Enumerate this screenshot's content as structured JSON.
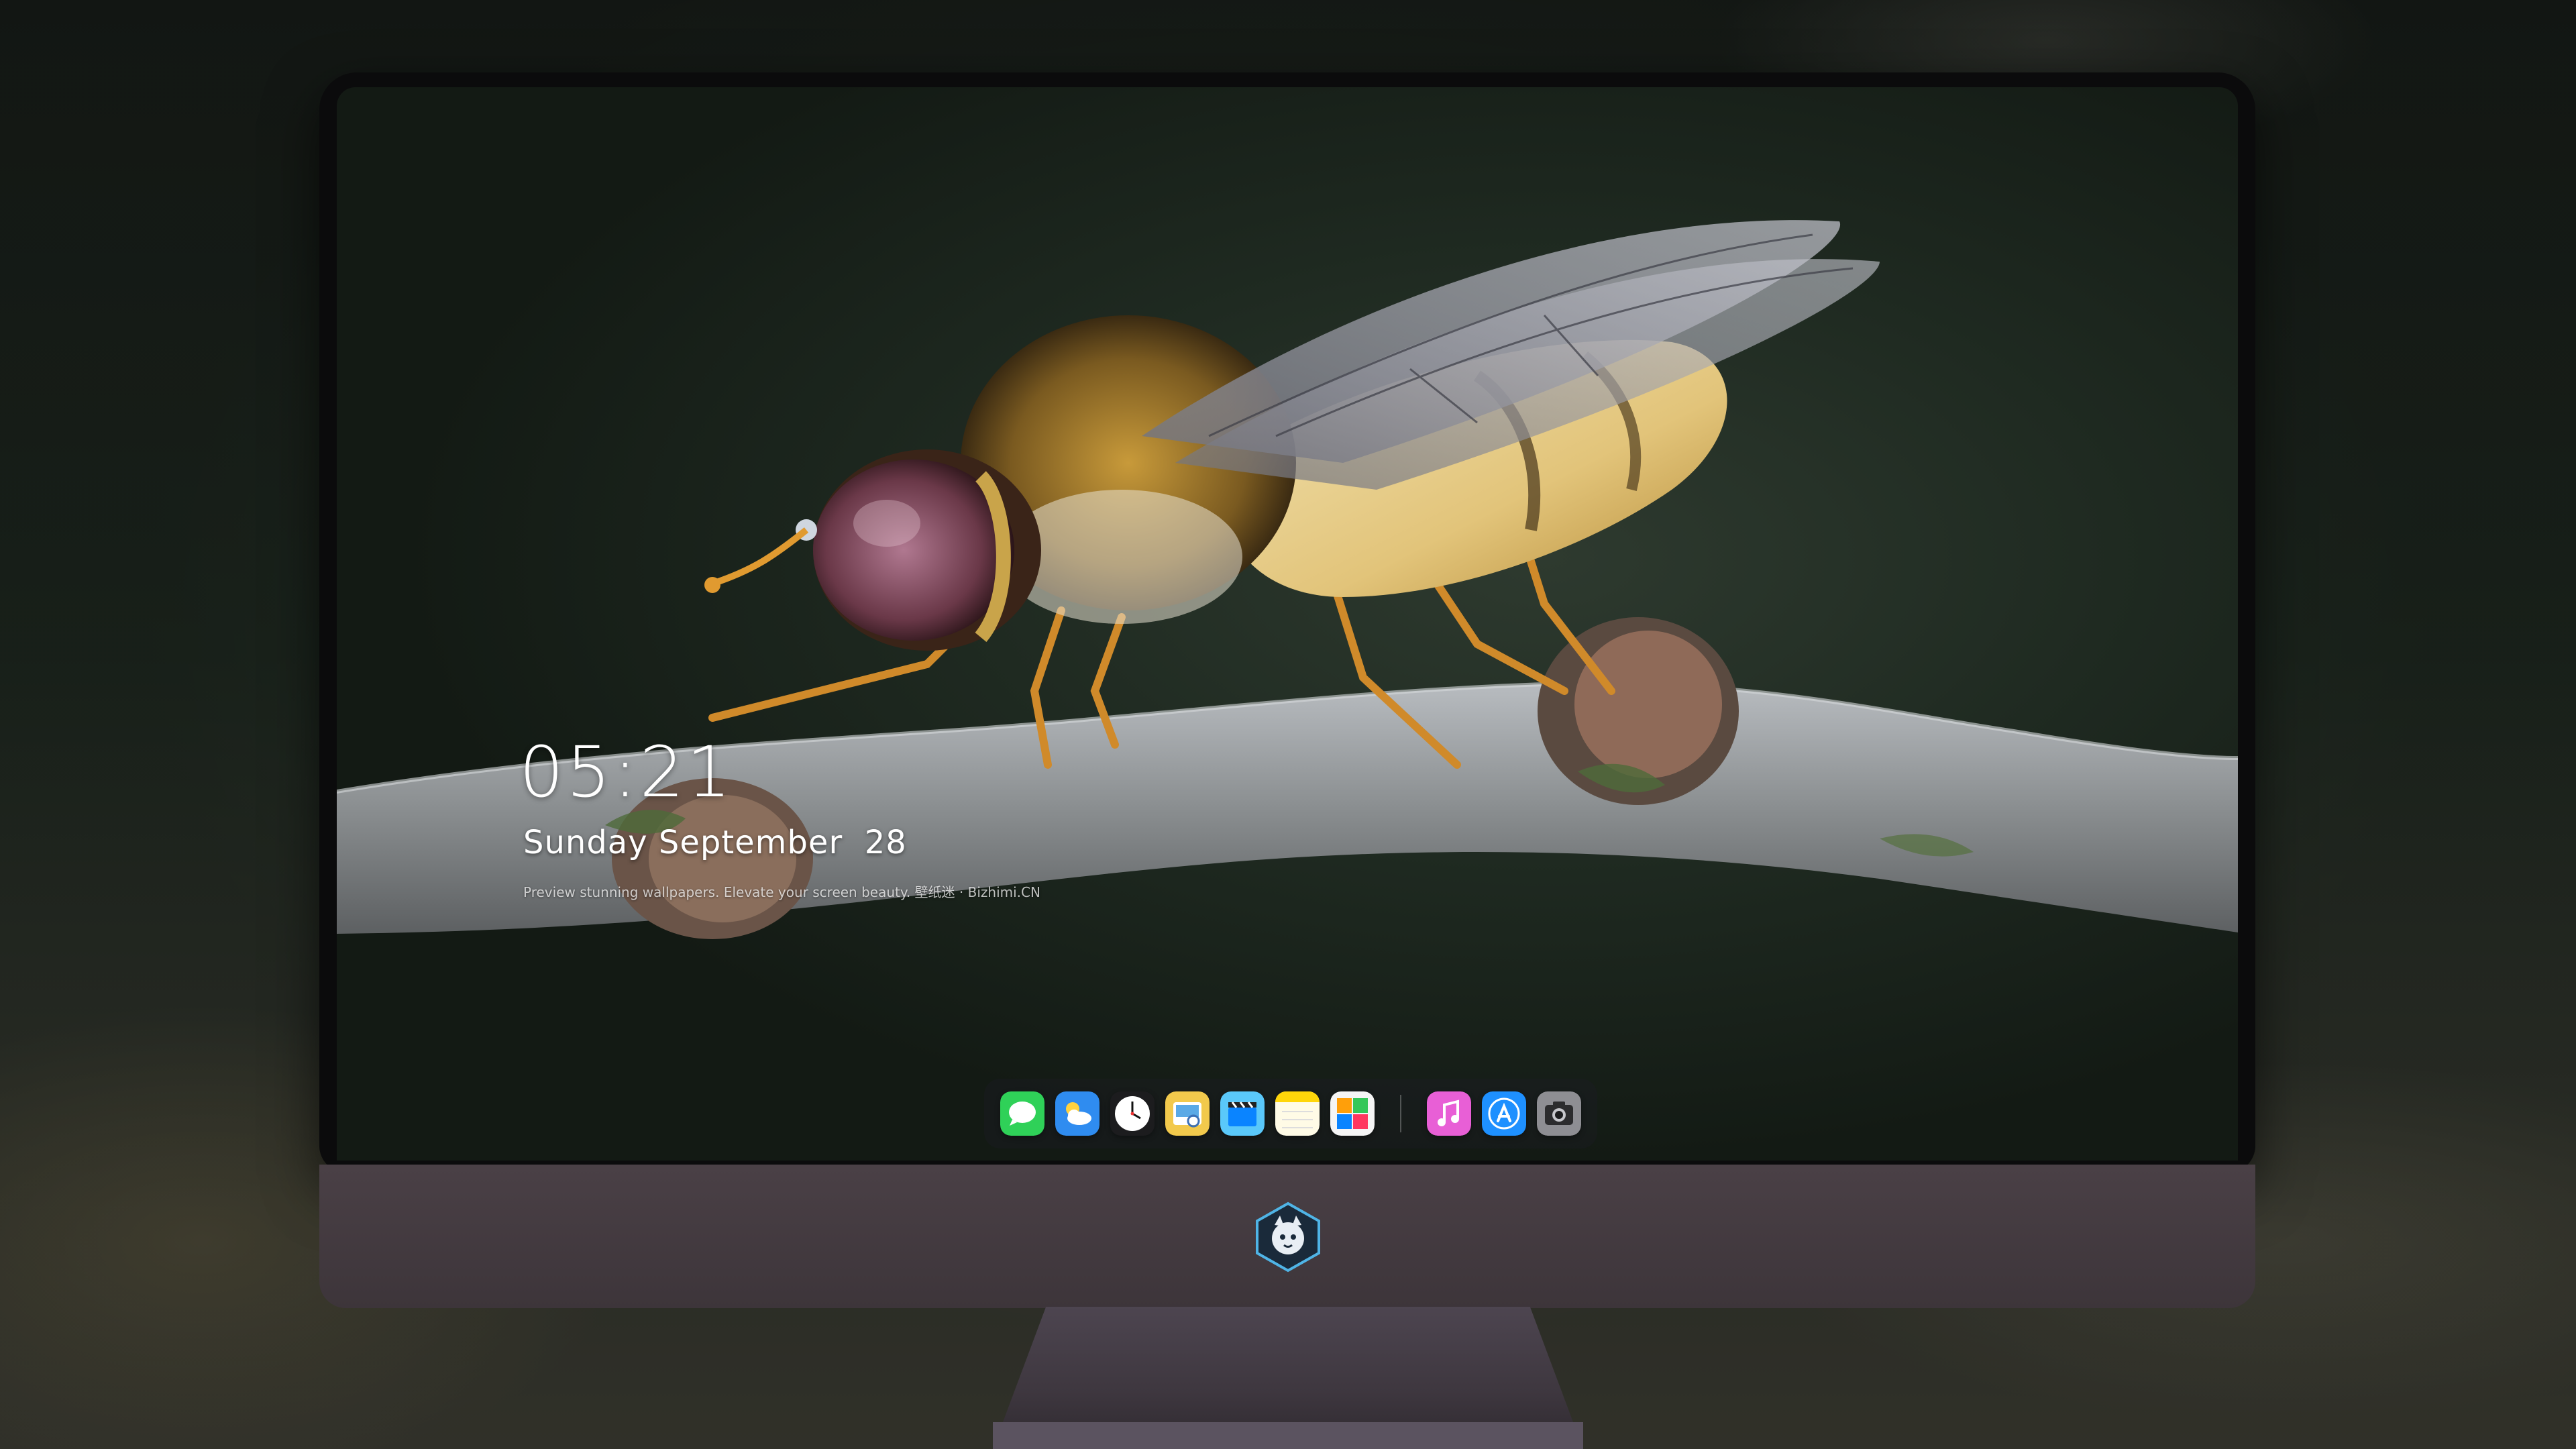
{
  "lock_screen": {
    "time": "05:21",
    "date": "Sunday September  28",
    "caption": "Preview stunning wallpapers. Elevate your screen beauty. 壁纸迷 · Bizhimi.CN"
  },
  "dock": {
    "apps": [
      {
        "name": "messages-icon",
        "color": "#2fd158"
      },
      {
        "name": "weather-icon",
        "color": "#2f8cf0"
      },
      {
        "name": "clock-icon",
        "color": "#1c1c1e"
      },
      {
        "name": "preview-icon",
        "color": "#f2c94c"
      },
      {
        "name": "clips-icon",
        "color": "#5ac8fa"
      },
      {
        "name": "notes-icon",
        "color": "#ffd60a"
      },
      {
        "name": "photo-booth-icon",
        "color": "#f5f5f5"
      },
      {
        "name": "music-icon",
        "color": "#e85fd6"
      },
      {
        "name": "app-store-icon",
        "color": "#1e90ff"
      },
      {
        "name": "camera-icon",
        "color": "#8e8e93"
      }
    ]
  },
  "colors": {
    "wallpaper_bg": "#1f2a21",
    "bezel": "#0b0b0c",
    "chin": "#453c42"
  }
}
